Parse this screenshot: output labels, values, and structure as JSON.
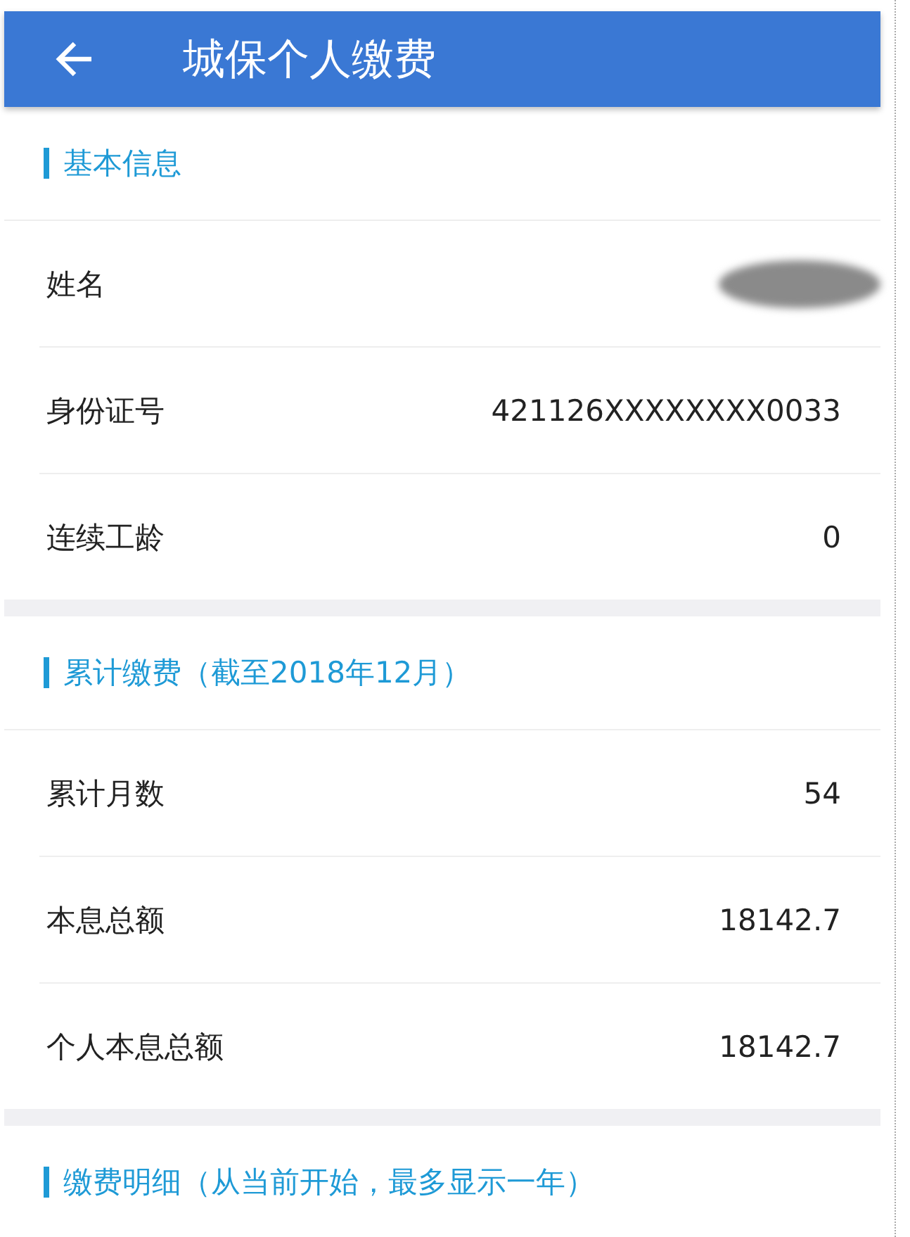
{
  "app_bar": {
    "title": "城保个人缴费"
  },
  "sections": [
    {
      "title": "基本信息",
      "rows": [
        {
          "label": "姓名",
          "kind": "redacted"
        },
        {
          "label": "身份证号",
          "kind": "text",
          "value": "421126XXXXXXXX0033"
        },
        {
          "label": "连续工龄",
          "kind": "text",
          "value": "0"
        }
      ]
    },
    {
      "title": "累计缴费（截至2018年12月）",
      "rows": [
        {
          "label": "累计月数",
          "kind": "text",
          "value": "54"
        },
        {
          "label": "本息总额",
          "kind": "text",
          "value": "18142.7"
        },
        {
          "label": "个人本息总额",
          "kind": "text",
          "value": "18142.7"
        }
      ]
    },
    {
      "title": "缴费明细（从当前开始，最多显示一年）"
    }
  ]
}
